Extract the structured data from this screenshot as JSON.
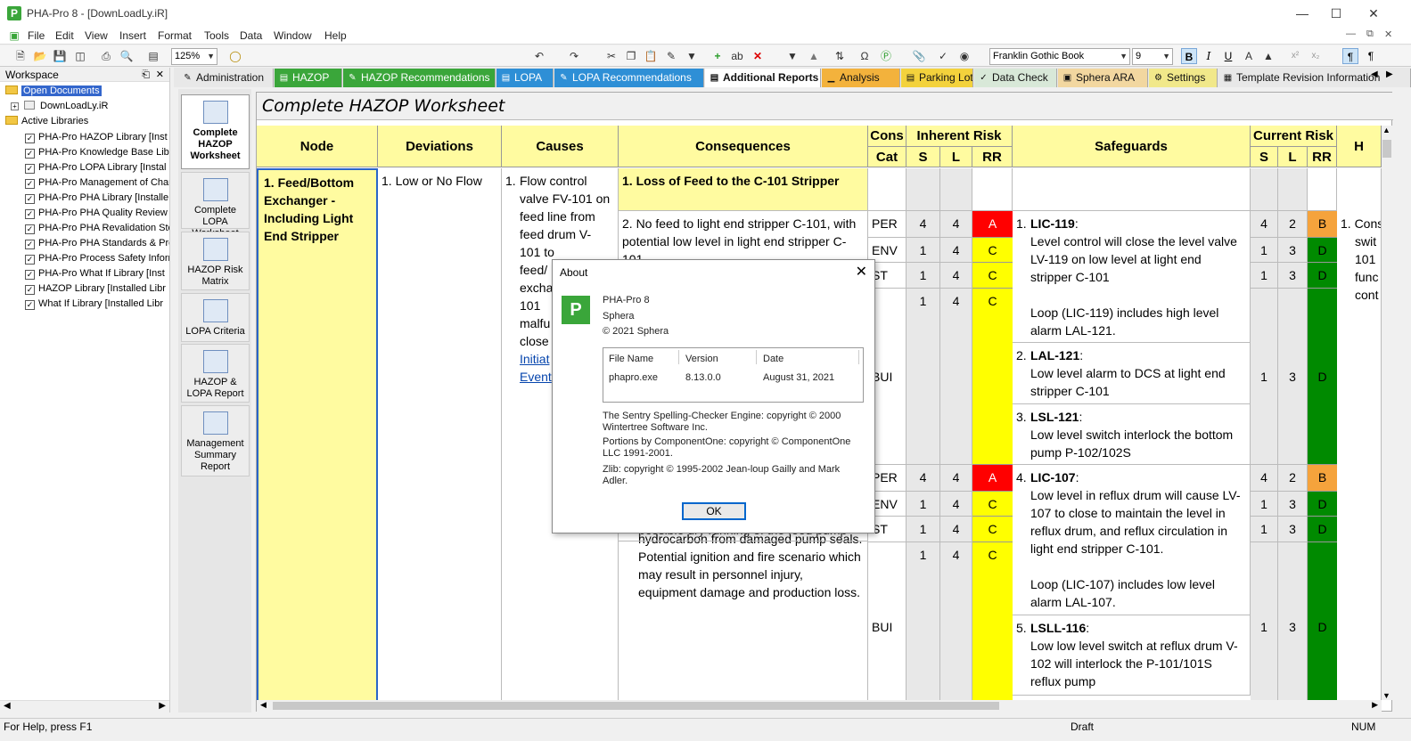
{
  "window": {
    "title": "PHA-Pro 8 - [DownLoadLy.iR]",
    "logo": "P"
  },
  "menu": [
    "File",
    "Edit",
    "View",
    "Insert",
    "Format",
    "Tools",
    "Data",
    "Window",
    "Help"
  ],
  "toolbar": {
    "zoom": "125%",
    "font_name": "Franklin Gothic Book",
    "font_size": "9",
    "bold": "B",
    "italic": "I",
    "underline": "U"
  },
  "workspace": {
    "title": "Workspace",
    "open_documents": "Open Documents",
    "doc": "DownLoadLy.iR",
    "active_libraries": "Active Libraries",
    "libraries": [
      "PHA-Pro HAZOP Library   [Inst",
      "PHA-Pro Knowledge Base Libra",
      "PHA-Pro LOPA Library   [Instal",
      "PHA-Pro Management of Chan",
      "PHA-Pro PHA Library   [Installe",
      "PHA-Pro PHA Quality Review L",
      "PHA-Pro PHA Revalidation Ste",
      "PHA-Pro PHA Standards & Prot",
      "PHA-Pro Process Safety Inform",
      "PHA-Pro What If Library   [Inst",
      "HAZOP Library   [Installed Libr",
      "What If Library   [Installed Libr"
    ]
  },
  "tabs": [
    {
      "label": "Administration",
      "bg": "#e8e8e8"
    },
    {
      "label": "HAZOP",
      "bg": "#3aa63a"
    },
    {
      "label": "HAZOP Recommendations",
      "bg": "#3aa63a"
    },
    {
      "label": "LOPA",
      "bg": "#2e8fd6"
    },
    {
      "label": "LOPA Recommendations",
      "bg": "#2e8fd6"
    },
    {
      "label": "Additional Reports",
      "bg": "#ffffff"
    },
    {
      "label": "Analysis",
      "bg": "#f3b23c"
    },
    {
      "label": "Parking Lot",
      "bg": "#f3d23c"
    },
    {
      "label": "Data Check",
      "bg": "#d8e8d8"
    },
    {
      "label": "Sphera ARA",
      "bg": "#f2d7a0"
    },
    {
      "label": "Settings",
      "bg": "#f1e88a"
    },
    {
      "label": "Template Revision Information",
      "bg": "#e8e8e8"
    }
  ],
  "reports": [
    "Complete HAZOP Worksheet",
    "Complete LOPA Worksheet",
    "HAZOP Risk Matrix",
    "LOPA Criteria",
    "HAZOP & LOPA Report",
    "Management Summary Report"
  ],
  "worksheet": {
    "title": "Complete HAZOP Worksheet",
    "headers": {
      "node": "Node",
      "deviations": "Deviations",
      "causes": "Causes",
      "consequences": "Consequences",
      "cons": "Cons",
      "cat": "Cat",
      "inherent": "Inherent Risk",
      "safeguards": "Safeguards",
      "current": "Current Risk",
      "s": "S",
      "l": "L",
      "rr": "RR",
      "h": "H"
    },
    "node": "1.  Feed/Bottom Exchanger - Including Light End Stripper",
    "deviation": "1.  Low or No Flow",
    "cause_num": "1.",
    "cause_lines": [
      "Flow control",
      "valve FV-101 on",
      "feed line from",
      "feed drum V-",
      "101 to",
      "feed/",
      "excha",
      "101",
      "malfu",
      "close"
    ],
    "cause_links": [
      "Initiat",
      "Event"
    ],
    "consequence_head": "1.  Loss of Feed to the C-101 Stripper",
    "consequence_2": "2. No feed to light end stripper C-101, with potential low level in light end stripper C-101",
    "consequence_lower": "P-101/P-101S. The pump could be damaged, with potential for a release of hydrocarbon from damaged pump seals. Potential ignition and fire scenario which may result in personnel injury, equipment damage and production loss.",
    "consequence_lower_partial": "possible dry running of the feed pump",
    "cats": [
      "PER",
      "ENV",
      "EST",
      "BUI",
      "PER",
      "ENV",
      "EST",
      "BUI"
    ],
    "cats_visible": [
      "PER",
      "ENV",
      "ST",
      "BUI",
      "PER",
      "ENV",
      "ST",
      "BUI"
    ],
    "inherent": [
      {
        "s": "4",
        "l": "4",
        "rr": "A"
      },
      {
        "s": "1",
        "l": "4",
        "rr": "C"
      },
      {
        "s": "1",
        "l": "4",
        "rr": "C"
      },
      {
        "s": "1",
        "l": "4",
        "rr": "C"
      },
      {
        "s": "4",
        "l": "4",
        "rr": "A"
      },
      {
        "s": "1",
        "l": "4",
        "rr": "C"
      },
      {
        "s": "1",
        "l": "4",
        "rr": "C"
      },
      {
        "s": "1",
        "l": "4",
        "rr": "C"
      }
    ],
    "safeguards": [
      {
        "num": "1.",
        "tag": "LIC-119",
        "text": "Level control will close the level valve LV-119 on low level at light end stripper C-101",
        "extra": "Loop (LIC-119) includes high  level alarm LAL-121."
      },
      {
        "num": "2.",
        "tag": "LAL-121",
        "text": "Low level alarm to DCS at light end stripper C-101"
      },
      {
        "num": "3.",
        "tag": "LSL-121",
        "text": "Low level switch interlock the bottom pump P-102/102S"
      },
      {
        "num": "4.",
        "tag": "LIC-107",
        "text": "Low level in reflux drum will cause LV-107 to close to maintain the level in reflux drum, and reflux circulation in light end stripper C-101.",
        "extra": "Loop (LIC-107) includes low level alarm LAL-107."
      },
      {
        "num": "5.",
        "tag": "LSLL-116",
        "text": "Low low level switch at reflux drum V-102 will interlock the P-101/101S reflux pump"
      }
    ],
    "current": [
      {
        "s": "4",
        "l": "2",
        "rr": "B"
      },
      {
        "s": "1",
        "l": "3",
        "rr": "D"
      },
      {
        "s": "1",
        "l": "3",
        "rr": "D"
      },
      {
        "s": "1",
        "l": "3",
        "rr": "D"
      },
      {
        "s": "4",
        "l": "2",
        "rr": "B"
      },
      {
        "s": "1",
        "l": "3",
        "rr": "D"
      },
      {
        "s": "1",
        "l": "3",
        "rr": "D"
      },
      {
        "s": "1",
        "l": "3",
        "rr": "D"
      }
    ],
    "recommend_lines": [
      "1. Cons",
      "swit",
      "101",
      "func",
      "cont"
    ]
  },
  "about": {
    "title": "About",
    "app": "PHA-Pro 8",
    "company": "Sphera",
    "copyright": "© 2021 Sphera",
    "file_label": "File Name",
    "version_label": "Version",
    "date_label": "Date",
    "file": "phapro.exe",
    "version": "8.13.0.0",
    "date": "August 31, 2021",
    "credit1": "The Sentry Spelling-Checker Engine: copyright © 2000 Wintertree Software Inc.",
    "credit2": "Portions by ComponentOne: copyright © ComponentOne LLC 1991-2001.",
    "credit3": "Zlib: copyright  © 1995-2002 Jean-loup Gailly and Mark Adler.",
    "ok": "OK"
  },
  "status": {
    "help": "For Help, press F1",
    "mode": "Draft",
    "num": "NUM"
  }
}
